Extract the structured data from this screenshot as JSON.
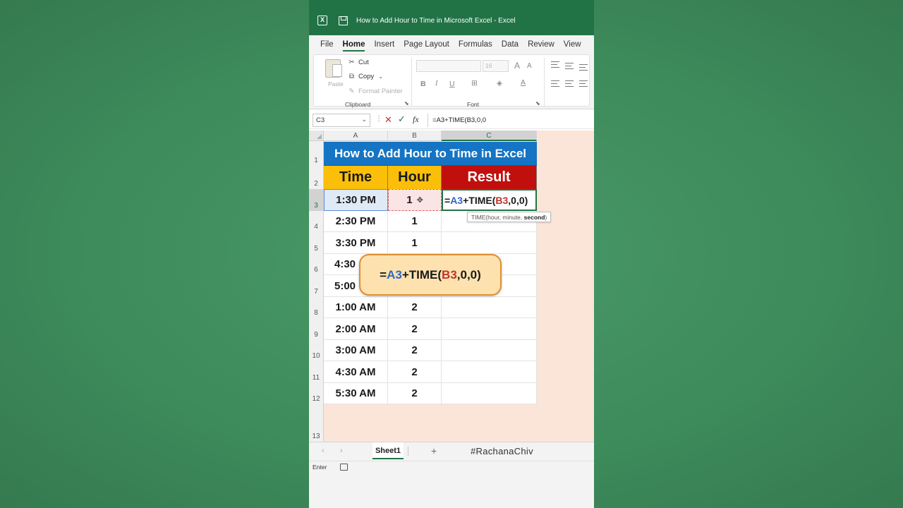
{
  "window": {
    "title": "How to Add Hour to Time in Microsoft Excel  -  Excel",
    "app_icon": "excel-icon",
    "save_icon": "save-icon"
  },
  "menu_tabs": [
    "File",
    "Home",
    "Insert",
    "Page Layout",
    "Formulas",
    "Data",
    "Review",
    "View"
  ],
  "active_tab": "Home",
  "ribbon": {
    "clipboard": {
      "label": "Clipboard",
      "paste": "Paste",
      "cut": "Cut",
      "copy": "Copy",
      "format_painter": "Format Painter"
    },
    "font": {
      "label": "Font",
      "font_size": "16",
      "bold": "B",
      "italic": "I",
      "underline": "U",
      "grow": "A",
      "shrink": "A",
      "font_color": "A"
    }
  },
  "formula_bar": {
    "name_box": "C3",
    "cancel": "✕",
    "enter": "✓",
    "fx": "fx",
    "formula": "=A3+TIME(B3,0,0"
  },
  "grid": {
    "columns": [
      "A",
      "B",
      "C"
    ],
    "rows": [
      "1",
      "2",
      "3",
      "4",
      "5",
      "6",
      "7",
      "8",
      "9",
      "10",
      "11",
      "12",
      "13"
    ],
    "banner": "How to Add Hour to Time in Excel",
    "headers": {
      "time": "Time",
      "hour": "Hour",
      "result": "Result"
    },
    "data_rows": [
      {
        "time": "1:30 PM",
        "hour": "1"
      },
      {
        "time": "2:30 PM",
        "hour": "1"
      },
      {
        "time": "3:30 PM",
        "hour": "1"
      },
      {
        "time": "4:30",
        "hour": ""
      },
      {
        "time": "5:00",
        "hour": ""
      },
      {
        "time": "1:00 AM",
        "hour": "2"
      },
      {
        "time": "2:00 AM",
        "hour": "2"
      },
      {
        "time": "3:00 AM",
        "hour": "2"
      },
      {
        "time": "4:30 AM",
        "hour": "2"
      },
      {
        "time": "5:30 AM",
        "hour": "2"
      }
    ],
    "c3_formula": {
      "eq": "=",
      "ref_a": "A3",
      "mid": "+TIME(",
      "ref_b": "B3",
      "tail": ",0,0)"
    },
    "tooltip": {
      "prefix": "TIME(hour, minute, ",
      "bold": "second",
      "suffix": ")"
    },
    "callout": {
      "eq": "=",
      "ref_a": "A3",
      "mid": "+TIME(",
      "ref_b": "B3",
      "tail": ",0,0)"
    }
  },
  "sheet_bar": {
    "sheet_name": "Sheet1",
    "add": "+",
    "prev": "‹",
    "next": "›",
    "handle": "#RachanaChiv"
  },
  "status_bar": {
    "mode": "Enter"
  },
  "colors": {
    "excel_green": "#217346",
    "banner_blue": "#1574c4",
    "header_yellow": "#fbbf0a",
    "result_red": "#c00f0c",
    "sheet_bg": "#fbe4d8",
    "callout_fill": "#fde2b0",
    "callout_border": "#e08f2e",
    "ref_a_color": "#3166c2",
    "ref_b_color": "#c0332b"
  }
}
